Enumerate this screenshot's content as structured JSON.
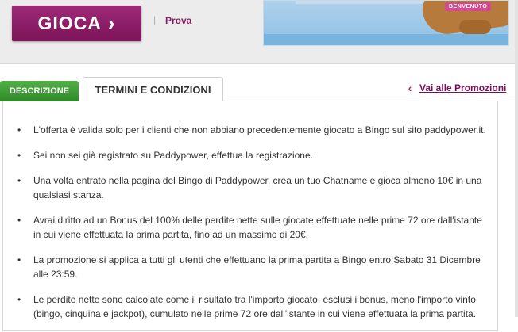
{
  "header": {
    "play_label": "GIOCA",
    "play_icon": "chevron-right-icon",
    "separator": "|",
    "try_label": "Prova",
    "banner_ribbon": "BENVENUTO"
  },
  "tabs": [
    {
      "label": "DESCRIZIONE",
      "active": false
    },
    {
      "label": "TERMINI E CONDIZIONI",
      "active": true
    }
  ],
  "promo_link": {
    "icon": "chevron-left-icon",
    "label": "Vai alle Promozioni"
  },
  "terms": [
    "L'offerta è valida solo per i clienti che non abbiano precedentemente giocato a Bingo sul sito paddypower.it.",
    "Sei non sei già registrato su Paddypower, effettua la registrazione.",
    "Una volta entrato nella pagina del Bingo di Paddypower, crea un tuo Chatname e gioca almeno 10€ in una qualsiasi stanza.",
    "Avrai diritto ad un Bonus del 100% delle perdite nette sulle giocate effettuate nelle prime 72 ore dall'istante in cui viene effettuata la prima partita, fino ad un massimo di 20€.",
    "La promozione si applica a tutti gli utenti che effettuano la prima partita a Bingo entro Sabato 31 Dicembre alle 23:59.",
    "Le perdite nette sono calcolate come il risultato tra l'importo giocato, esclusi i bonus, meno l'importo vinto (bingo, cinquina e jackpot), cumulato nelle prime 72 ore dall'istante in cui viene effettuata la prima partita."
  ],
  "colors": {
    "brand": "#8a1e63",
    "tab_green": "#3a9a33",
    "link": "#7a0e58"
  }
}
